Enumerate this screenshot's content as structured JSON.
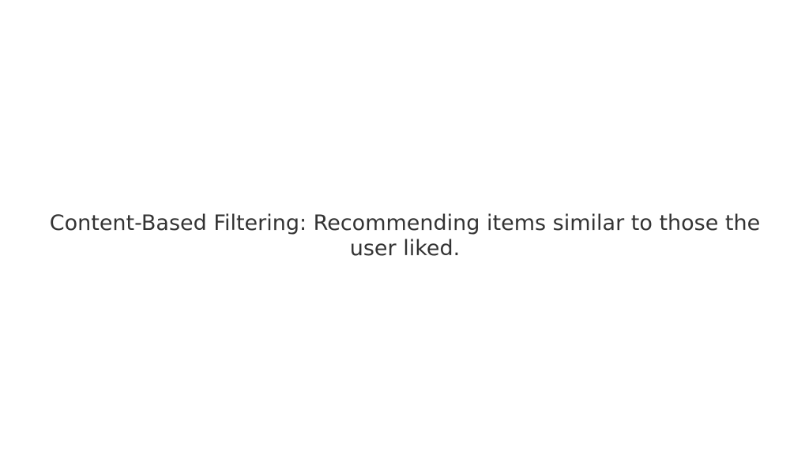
{
  "caption": {
    "text": "Content-Based Filtering: Recommending items similar to those the user liked.",
    "color": "#333333"
  },
  "background_color": "#ffffff"
}
